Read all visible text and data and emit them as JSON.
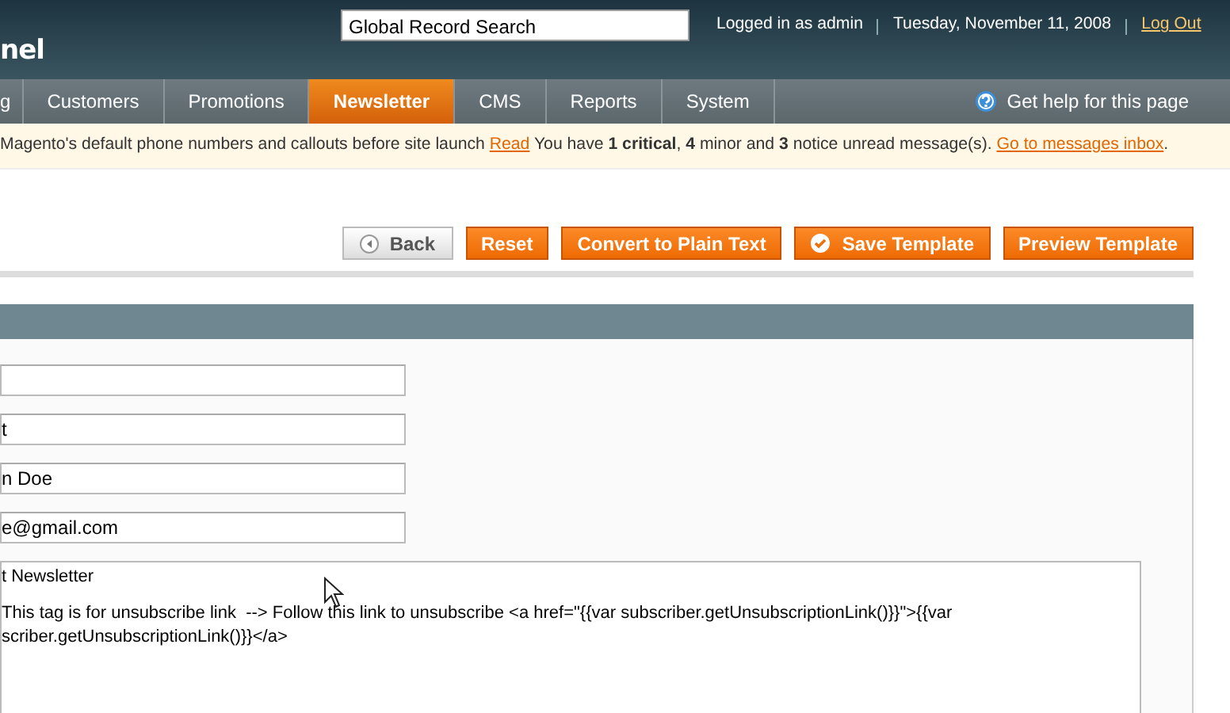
{
  "header": {
    "logo_text": "nel",
    "search": {
      "value": "Global Record Search"
    },
    "user": "Logged in as admin",
    "date": "Tuesday, November 11, 2008",
    "logout": "Log Out"
  },
  "nav": [
    {
      "label": "g",
      "selected": false
    },
    {
      "label": "Customers",
      "selected": false
    },
    {
      "label": "Promotions",
      "selected": false
    },
    {
      "label": "Newsletter",
      "selected": true
    },
    {
      "label": "CMS",
      "selected": false
    },
    {
      "label": "Reports",
      "selected": false
    },
    {
      "label": "System",
      "selected": false
    }
  ],
  "help": "Get help for this page",
  "notice": {
    "text": "Magento's default phone numbers and callouts before site launch",
    "link": "Read",
    "critical": "You have **1 critical**",
    "rest": ", **4** minor and **3** notice unread message(s).",
    "inbox_link": "Go to messages inbox",
    "tail": "."
  },
  "buttons": [
    {
      "kind": "back",
      "label": "Back"
    },
    {
      "kind": "primary",
      "label": "Reset"
    },
    {
      "kind": "primary",
      "label": "Convert to Plain Text"
    },
    {
      "kind": "save",
      "label": "Save Template"
    },
    {
      "kind": "primary",
      "label": "Preview Template"
    }
  ],
  "fields": [
    {
      "kind": "text"
    },
    {
      "kind": "text",
      "value": "t"
    },
    {
      "kind": "text",
      "value": "n Doe"
    },
    {
      "kind": "text",
      "value": "e@gmail.com"
    }
  ],
  "template_text": {
    "paragraphs": [
      [
        "t Newsletter"
      ],
      [
        "This tag is for unsubscribe link  --> Follow this link to unsubscribe <a href=\"{{var subscriber.getUnsubscriptionLink()}}\">{{var",
        "scriber.getUnsubscriptionLink()}}</a>"
      ]
    ]
  }
}
